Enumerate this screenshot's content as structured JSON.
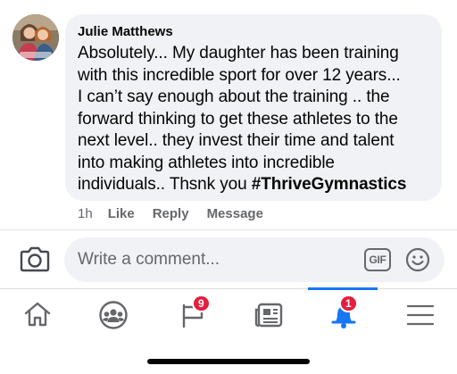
{
  "comment": {
    "author": "Julie Matthews",
    "lines": [
      "Absolutely... My daughter has been training",
      "with this incredible sport for over 12 years...",
      "I can’t say enough about the training .. the",
      "forward thinking to get these athletes to the",
      "next level..  they invest their time and talent",
      "into making athletes into incredible"
    ],
    "last_line_text": "individuals.. Thsnk you ",
    "hashtag": "#ThriveGymnastics",
    "time": "1h",
    "actions": {
      "like": "Like",
      "reply": "Reply",
      "message": "Message"
    }
  },
  "composer": {
    "placeholder": "Write a comment...",
    "gif_label": "GIF"
  },
  "nav": {
    "items": [
      {
        "name": "home",
        "icon": "home-icon"
      },
      {
        "name": "groups",
        "icon": "groups-icon"
      },
      {
        "name": "pages",
        "icon": "flag-icon",
        "badge": "9"
      },
      {
        "name": "news",
        "icon": "newspaper-icon"
      },
      {
        "name": "notifications",
        "icon": "bell-icon",
        "badge": "1",
        "active": true
      },
      {
        "name": "menu",
        "icon": "hamburger-menu-icon"
      }
    ]
  },
  "colors": {
    "accent": "#1877f2",
    "badge": "#e41e3f",
    "bubble": "#f0f2f5",
    "secondary_text": "#65676b"
  }
}
